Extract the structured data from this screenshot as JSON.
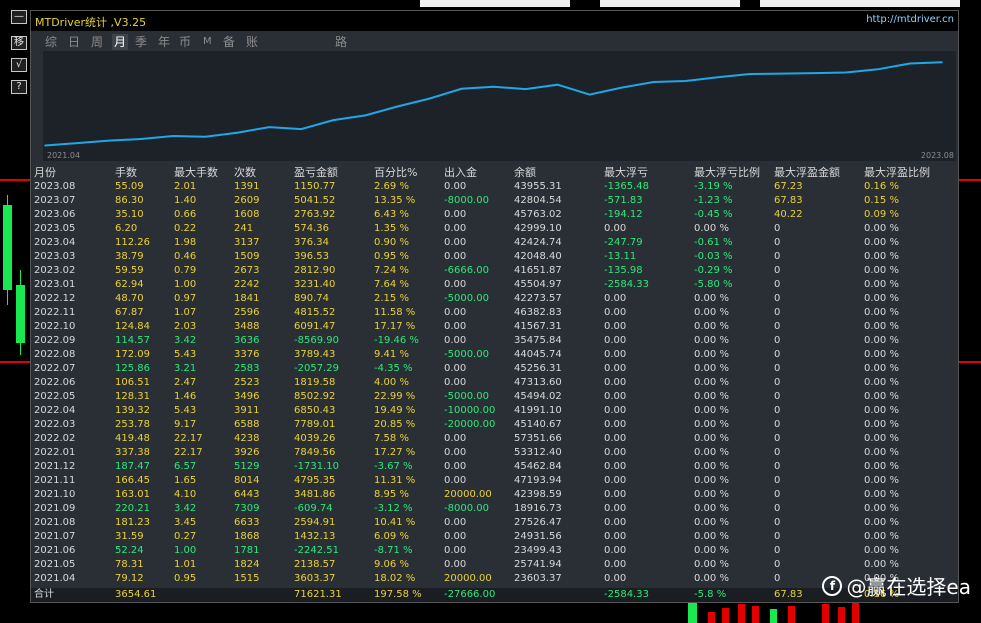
{
  "window": {
    "title": "MTDriver统计 ,V3.25",
    "url": "http://mtdriver.cn"
  },
  "toolbar": {
    "items": [
      "移",
      "√",
      "?"
    ]
  },
  "tabs": [
    {
      "label": "综",
      "active": false
    },
    {
      "label": "日",
      "active": false
    },
    {
      "label": "周",
      "active": false
    },
    {
      "label": "月",
      "active": true
    },
    {
      "label": "季",
      "active": false
    },
    {
      "label": "年",
      "active": false
    },
    {
      "label": "币",
      "active": false
    },
    {
      "label": "M",
      "active": false
    },
    {
      "label": "备",
      "active": false
    },
    {
      "label": "账户",
      "active": false
    },
    {
      "label": "路径",
      "active": false
    }
  ],
  "chart_data": {
    "type": "line",
    "x_start_label": "2021.04",
    "x_end_label": "2023.08",
    "x": [
      "2021.04",
      "2021.05",
      "2021.06",
      "2021.07",
      "2021.08",
      "2021.09",
      "2021.10",
      "2021.11",
      "2021.12",
      "2022.01",
      "2022.02",
      "2022.03",
      "2022.04",
      "2022.05",
      "2022.06",
      "2022.07",
      "2022.08",
      "2022.09",
      "2022.10",
      "2022.11",
      "2022.12",
      "2023.01",
      "2023.02",
      "2023.03",
      "2023.04",
      "2023.05",
      "2023.06",
      "2023.07",
      "2023.08"
    ],
    "y": [
      3603.37,
      5741.94,
      7880.51,
      9312.64,
      11907.55,
      11297.81,
      14779.67,
      19575.02,
      17843.92,
      25693.48,
      29732.74,
      37521.75,
      44372.18,
      52875.1,
      54694.68,
      52637.39,
      56426.82,
      47856.92,
      53948.39,
      58763.91,
      59654.65,
      62886.05,
      65698.95,
      66095.48,
      66471.84,
      67046.2,
      69810.12,
      74851.64,
      76002.41
    ],
    "line_color": "#1fa8e8",
    "grid": false
  },
  "table": {
    "headers": [
      "月份",
      "手数",
      "最大手数",
      "次数",
      "盈亏金额",
      "百分比%",
      "出入金",
      "余额",
      "最大浮亏",
      "最大浮亏比例",
      "最大浮盈金额",
      "最大浮盈比例"
    ],
    "rows": [
      {
        "c": [
          "2023.08",
          "55.09",
          "2.01",
          "1391",
          "1150.77",
          "2.69 %",
          "0.00",
          "43955.31",
          "-1365.48",
          "-3.19 %",
          "67.23",
          "0.16 %"
        ],
        "pos": true
      },
      {
        "c": [
          "2023.07",
          "86.30",
          "1.40",
          "2609",
          "5041.52",
          "13.35 %",
          "-8000.00",
          "42804.54",
          "-571.83",
          "-1.23 %",
          "67.83",
          "0.15 %"
        ],
        "pos": true
      },
      {
        "c": [
          "2023.06",
          "35.10",
          "0.66",
          "1608",
          "2763.92",
          "6.43 %",
          "0.00",
          "45763.02",
          "-194.12",
          "-0.45 %",
          "40.22",
          "0.09 %"
        ],
        "pos": true
      },
      {
        "c": [
          "2023.05",
          "6.20",
          "0.22",
          "241",
          "574.36",
          "1.35 %",
          "0.00",
          "42999.10",
          "0.00",
          "0.00 %",
          "0",
          "0.00 %"
        ],
        "pos": true
      },
      {
        "c": [
          "2023.04",
          "112.26",
          "1.98",
          "3137",
          "376.34",
          "0.90 %",
          "0.00",
          "42424.74",
          "-247.79",
          "-0.61 %",
          "0",
          "0.00 %"
        ],
        "pos": true
      },
      {
        "c": [
          "2023.03",
          "38.79",
          "0.46",
          "1509",
          "396.53",
          "0.95 %",
          "0.00",
          "42048.40",
          "-13.11",
          "-0.03 %",
          "0",
          "0.00 %"
        ],
        "pos": true
      },
      {
        "c": [
          "2023.02",
          "59.59",
          "0.79",
          "2673",
          "2812.90",
          "7.24 %",
          "-6666.00",
          "41651.87",
          "-135.98",
          "-0.29 %",
          "0",
          "0.00 %"
        ],
        "pos": true
      },
      {
        "c": [
          "2023.01",
          "62.94",
          "1.00",
          "2242",
          "3231.40",
          "7.64 %",
          "0.00",
          "45504.97",
          "-2584.33",
          "-5.80 %",
          "0",
          "0.00 %"
        ],
        "pos": true
      },
      {
        "c": [
          "2022.12",
          "48.70",
          "0.97",
          "1841",
          "890.74",
          "2.15 %",
          "-5000.00",
          "42273.57",
          "0.00",
          "0.00 %",
          "0",
          "0.00 %"
        ],
        "pos": true
      },
      {
        "c": [
          "2022.11",
          "67.87",
          "1.07",
          "2596",
          "4815.52",
          "11.58 %",
          "0.00",
          "46382.83",
          "0.00",
          "0.00 %",
          "0",
          "0.00 %"
        ],
        "pos": true
      },
      {
        "c": [
          "2022.10",
          "124.84",
          "2.03",
          "3488",
          "6091.47",
          "17.17 %",
          "0.00",
          "41567.31",
          "0.00",
          "0.00 %",
          "0",
          "0.00 %"
        ],
        "pos": true
      },
      {
        "c": [
          "2022.09",
          "114.57",
          "3.42",
          "3636",
          "-8569.90",
          "-19.46 %",
          "0.00",
          "35475.84",
          "0.00",
          "0.00 %",
          "0",
          "0.00 %"
        ],
        "pos": false
      },
      {
        "c": [
          "2022.08",
          "172.09",
          "5.43",
          "3376",
          "3789.43",
          "9.41 %",
          "-5000.00",
          "44045.74",
          "0.00",
          "0.00 %",
          "0",
          "0.00 %"
        ],
        "pos": true
      },
      {
        "c": [
          "2022.07",
          "125.86",
          "3.21",
          "2583",
          "-2057.29",
          "-4.35 %",
          "0.00",
          "45256.31",
          "0.00",
          "0.00 %",
          "0",
          "0.00 %"
        ],
        "pos": false
      },
      {
        "c": [
          "2022.06",
          "106.51",
          "2.47",
          "2523",
          "1819.58",
          "4.00 %",
          "0.00",
          "47313.60",
          "0.00",
          "0.00 %",
          "0",
          "0.00 %"
        ],
        "pos": true
      },
      {
        "c": [
          "2022.05",
          "128.31",
          "1.46",
          "3496",
          "8502.92",
          "22.99 %",
          "-5000.00",
          "45494.02",
          "0.00",
          "0.00 %",
          "0",
          "0.00 %"
        ],
        "pos": true
      },
      {
        "c": [
          "2022.04",
          "139.32",
          "5.43",
          "3911",
          "6850.43",
          "19.49 %",
          "-10000.00",
          "41991.10",
          "0.00",
          "0.00 %",
          "0",
          "0.00 %"
        ],
        "pos": true
      },
      {
        "c": [
          "2022.03",
          "253.78",
          "9.17",
          "6588",
          "7789.01",
          "20.85 %",
          "-20000.00",
          "45140.67",
          "0.00",
          "0.00 %",
          "0",
          "0.00 %"
        ],
        "pos": true
      },
      {
        "c": [
          "2022.02",
          "419.48",
          "22.17",
          "4238",
          "4039.26",
          "7.58 %",
          "0.00",
          "57351.66",
          "0.00",
          "0.00 %",
          "0",
          "0.00 %"
        ],
        "pos": true
      },
      {
        "c": [
          "2022.01",
          "337.38",
          "22.17",
          "3926",
          "7849.56",
          "17.27 %",
          "0.00",
          "53312.40",
          "0.00",
          "0.00 %",
          "0",
          "0.00 %"
        ],
        "pos": true
      },
      {
        "c": [
          "2021.12",
          "187.47",
          "6.57",
          "5129",
          "-1731.10",
          "-3.67 %",
          "0.00",
          "45462.84",
          "0.00",
          "0.00 %",
          "0",
          "0.00 %"
        ],
        "pos": false
      },
      {
        "c": [
          "2021.11",
          "166.45",
          "1.65",
          "8014",
          "4795.35",
          "11.31 %",
          "0.00",
          "47193.94",
          "0.00",
          "0.00 %",
          "0",
          "0.00 %"
        ],
        "pos": true
      },
      {
        "c": [
          "2021.10",
          "163.01",
          "4.10",
          "6443",
          "3481.86",
          "8.95 %",
          "20000.00",
          "42398.59",
          "0.00",
          "0.00 %",
          "0",
          "0.00 %"
        ],
        "pos": true
      },
      {
        "c": [
          "2021.09",
          "220.21",
          "3.42",
          "7309",
          "-609.74",
          "-3.12 %",
          "-8000.00",
          "18916.73",
          "0.00",
          "0.00 %",
          "0",
          "0.00 %"
        ],
        "pos": false
      },
      {
        "c": [
          "2021.08",
          "181.23",
          "3.45",
          "6633",
          "2594.91",
          "10.41 %",
          "0.00",
          "27526.47",
          "0.00",
          "0.00 %",
          "0",
          "0.00 %"
        ],
        "pos": true
      },
      {
        "c": [
          "2021.07",
          "31.59",
          "0.27",
          "1868",
          "1432.13",
          "6.09 %",
          "0.00",
          "24931.56",
          "0.00",
          "0.00 %",
          "0",
          "0.00 %"
        ],
        "pos": true
      },
      {
        "c": [
          "2021.06",
          "52.24",
          "1.00",
          "1781",
          "-2242.51",
          "-8.71 %",
          "0.00",
          "23499.43",
          "0.00",
          "0.00 %",
          "0",
          "0.00 %"
        ],
        "pos": false
      },
      {
        "c": [
          "2021.05",
          "78.31",
          "1.01",
          "1824",
          "2138.57",
          "9.06 %",
          "0.00",
          "25741.94",
          "0.00",
          "0.00 %",
          "0",
          "0.00 %"
        ],
        "pos": true
      },
      {
        "c": [
          "2021.04",
          "79.12",
          "0.95",
          "1515",
          "3603.37",
          "18.02 %",
          "20000.00",
          "23603.37",
          "0.00",
          "0.00 %",
          "0",
          "0.00 %"
        ],
        "pos": true
      }
    ],
    "total": [
      "合计",
      "3654.61",
      "",
      "",
      "71621.31",
      "197.58 %",
      "-27666.00",
      "",
      "-2584.33",
      "-5.8 %",
      "67.83",
      "0.16 %"
    ]
  },
  "watermark": {
    "text": "@赢在选择ea"
  },
  "colors": {
    "positive": "#e8d23c",
    "negative": "#2ee87a",
    "neutral": "#d8d8d8",
    "title": "#e6d23a",
    "line": "#1fa8e8"
  }
}
